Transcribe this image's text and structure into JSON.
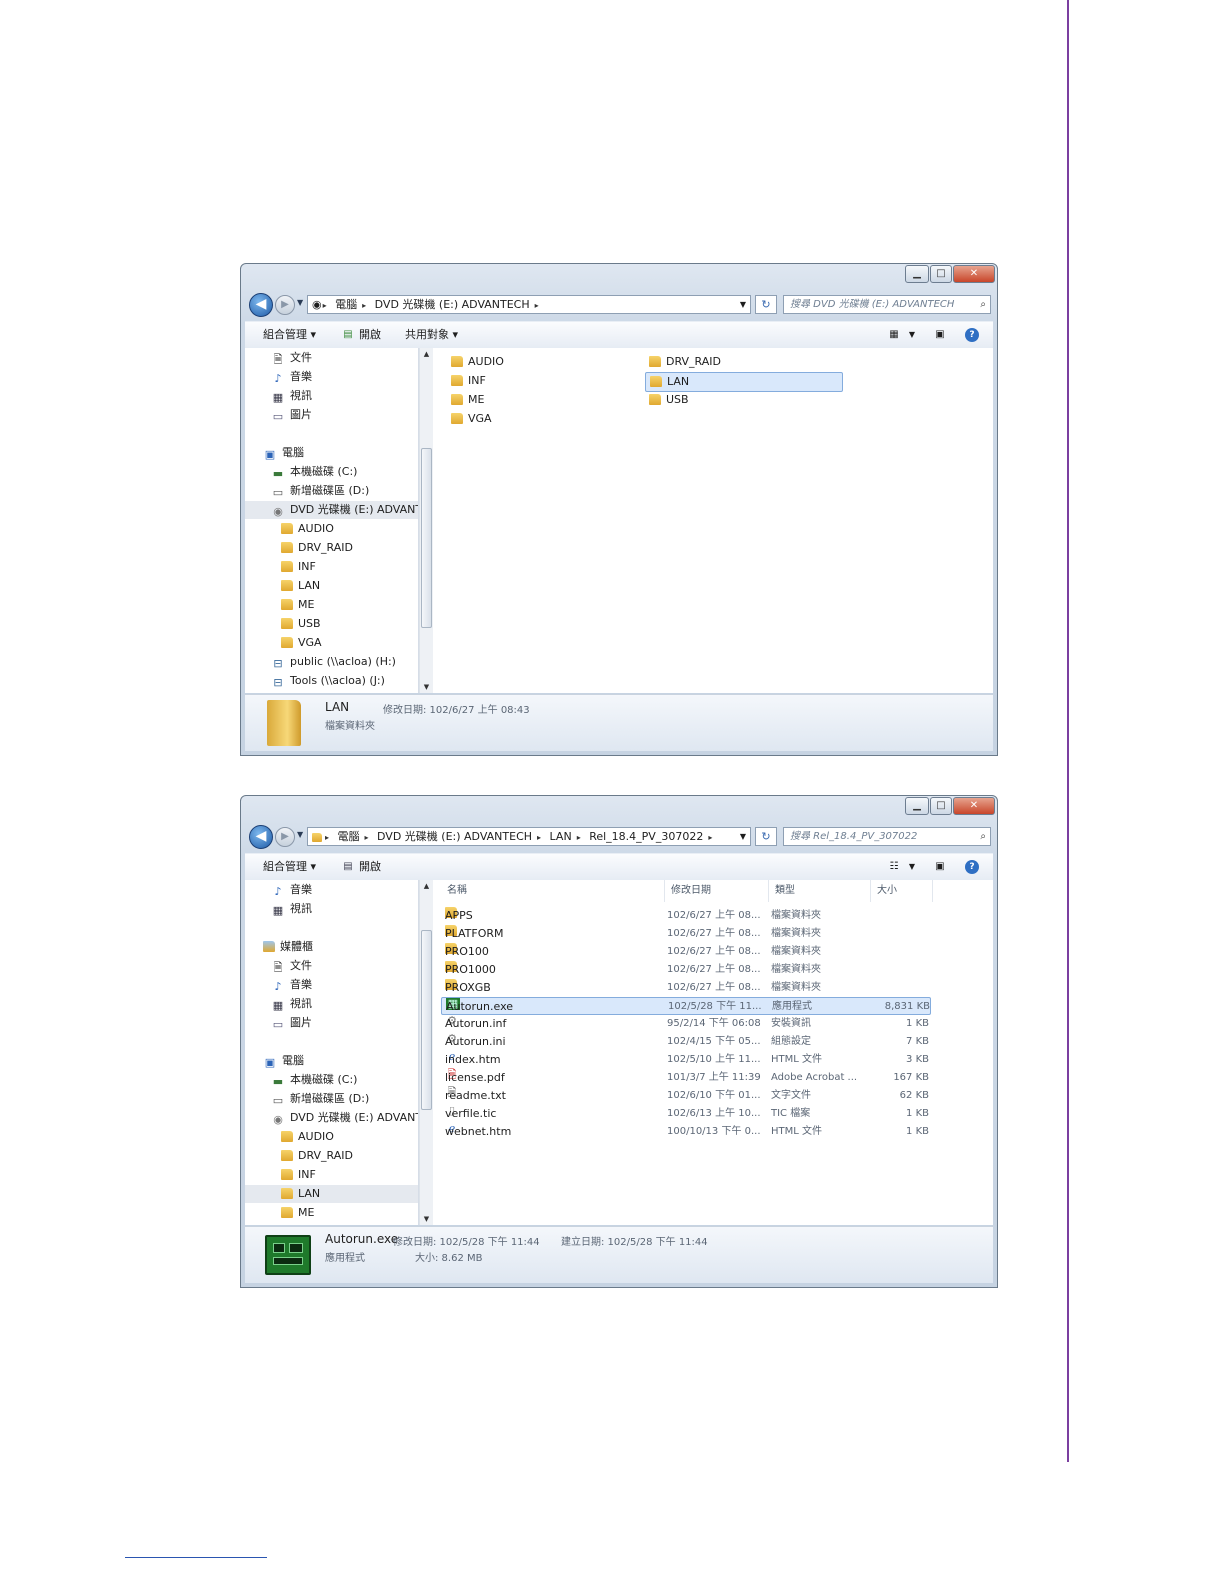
{
  "window1": {
    "address": [
      "電腦",
      "DVD 光碟機 (E:) ADVANTECH"
    ],
    "search_placeholder": "搜尋 DVD 光碟機 (E:) ADVANTECH",
    "toolbar": {
      "organize": "組合管理 ▾",
      "open": "開啟",
      "share": "共用對象 ▾"
    },
    "nav_items": [
      {
        "label": "文件",
        "icon": "document-icon"
      },
      {
        "label": "音樂",
        "icon": "music-icon"
      },
      {
        "label": "視訊",
        "icon": "video-icon"
      },
      {
        "label": "圖片",
        "icon": "picture-icon"
      },
      {
        "label": "電腦",
        "icon": "computer-icon"
      },
      {
        "label": "本機磁碟 (C:)",
        "icon": "local-disk-icon"
      },
      {
        "label": "新增磁碟區 (D:)",
        "icon": "drive-icon"
      },
      {
        "label": "DVD 光碟機 (E:) ADVANTE",
        "icon": "dvd-icon"
      },
      {
        "label": "AUDIO",
        "icon": "folder-icon"
      },
      {
        "label": "DRV_RAID",
        "icon": "folder-icon"
      },
      {
        "label": "INF",
        "icon": "folder-icon"
      },
      {
        "label": "LAN",
        "icon": "folder-icon"
      },
      {
        "label": "ME",
        "icon": "folder-icon"
      },
      {
        "label": "USB",
        "icon": "folder-icon"
      },
      {
        "label": "VGA",
        "icon": "folder-icon"
      },
      {
        "label": "public (\\\\acloa) (H:)",
        "icon": "network-drive-icon"
      },
      {
        "label": "Tools (\\\\acloa) (J:)",
        "icon": "network-drive-icon"
      }
    ],
    "files": [
      "AUDIO",
      "INF",
      "ME",
      "VGA",
      "DRV_RAID",
      "LAN",
      "USB"
    ],
    "status": {
      "name": "LAN",
      "modified": "修改日期: 102/6/27 上午 08:43",
      "type": "檔案資料夾"
    }
  },
  "window2": {
    "address": [
      "電腦",
      "DVD 光碟機 (E:) ADVANTECH",
      "LAN",
      "Rel_18.4_PV_307022"
    ],
    "search_placeholder": "搜尋 Rel_18.4_PV_307022",
    "toolbar": {
      "organize": "組合管理 ▾",
      "open": "開啟"
    },
    "nav_items": [
      {
        "label": "音樂",
        "icon": "music-icon"
      },
      {
        "label": "視訊",
        "icon": "video-icon"
      },
      {
        "label": "媒體櫃",
        "icon": "library-icon"
      },
      {
        "label": "文件",
        "icon": "document-icon"
      },
      {
        "label": "音樂",
        "icon": "music-icon"
      },
      {
        "label": "視訊",
        "icon": "video-icon"
      },
      {
        "label": "圖片",
        "icon": "picture-icon"
      },
      {
        "label": "電腦",
        "icon": "computer-icon"
      },
      {
        "label": "本機磁碟 (C:)",
        "icon": "local-disk-icon"
      },
      {
        "label": "新增磁碟區 (D:)",
        "icon": "drive-icon"
      },
      {
        "label": "DVD 光碟機 (E:) ADVANTE",
        "icon": "dvd-icon"
      },
      {
        "label": "AUDIO",
        "icon": "folder-icon"
      },
      {
        "label": "DRV_RAID",
        "icon": "folder-icon"
      },
      {
        "label": "INF",
        "icon": "folder-icon"
      },
      {
        "label": "LAN",
        "icon": "folder-icon"
      },
      {
        "label": "ME",
        "icon": "folder-icon"
      }
    ],
    "columns": [
      "名稱",
      "修改日期",
      "類型",
      "大小"
    ],
    "rows": [
      {
        "name": "APPS",
        "date": "102/6/27 上午 08...",
        "type": "檔案資料夾",
        "size": "",
        "icon": "folder-icon"
      },
      {
        "name": "PLATFORM",
        "date": "102/6/27 上午 08...",
        "type": "檔案資料夾",
        "size": "",
        "icon": "folder-icon"
      },
      {
        "name": "PRO100",
        "date": "102/6/27 上午 08...",
        "type": "檔案資料夾",
        "size": "",
        "icon": "folder-icon"
      },
      {
        "name": "PRO1000",
        "date": "102/6/27 上午 08...",
        "type": "檔案資料夾",
        "size": "",
        "icon": "folder-icon"
      },
      {
        "name": "PROXGB",
        "date": "102/6/27 上午 08...",
        "type": "檔案資料夾",
        "size": "",
        "icon": "folder-icon"
      },
      {
        "name": "Autorun.exe",
        "date": "102/5/28 下午 11...",
        "type": "應用程式",
        "size": "8,831 KB",
        "icon": "exe-icon"
      },
      {
        "name": "Autorun.inf",
        "date": "95/2/14 下午 06:08",
        "type": "安裝資訊",
        "size": "1 KB",
        "icon": "settings-file-icon"
      },
      {
        "name": "Autorun.ini",
        "date": "102/4/15 下午 05...",
        "type": "組態設定",
        "size": "7 KB",
        "icon": "settings-file-icon"
      },
      {
        "name": "index.htm",
        "date": "102/5/10 上午 11...",
        "type": "HTML 文件",
        "size": "3 KB",
        "icon": "html-icon"
      },
      {
        "name": "license.pdf",
        "date": "101/3/7 上午 11:39",
        "type": "Adobe Acrobat ...",
        "size": "167 KB",
        "icon": "pdf-icon"
      },
      {
        "name": "readme.txt",
        "date": "102/6/10 下午 01...",
        "type": "文字文件",
        "size": "62 KB",
        "icon": "text-file-icon"
      },
      {
        "name": "verfile.tic",
        "date": "102/6/13 上午 10...",
        "type": "TIC 檔案",
        "size": "1 KB",
        "icon": "blank-file-icon"
      },
      {
        "name": "webnet.htm",
        "date": "100/10/13 下午 0...",
        "type": "HTML 文件",
        "size": "1 KB",
        "icon": "html-icon"
      }
    ],
    "status": {
      "name": "Autorun.exe",
      "modified": "修改日期: 102/5/28 下午 11:44",
      "created": "建立日期: 102/5/28 下午 11:44",
      "type": "應用程式",
      "size": "大小: 8.62 MB"
    }
  }
}
